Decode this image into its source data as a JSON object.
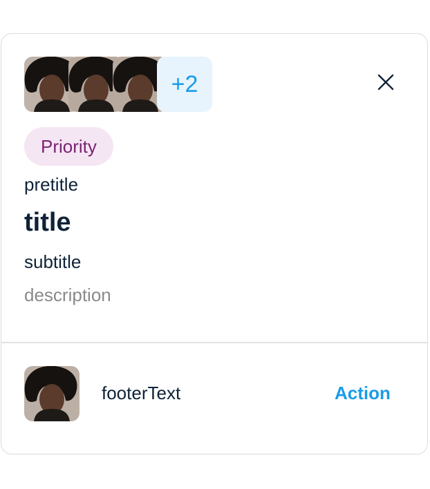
{
  "card": {
    "avatars": [
      "person-photo",
      "person-photo",
      "person-photo"
    ],
    "more_count": "+2",
    "close_icon": "close-icon",
    "badge": "Priority",
    "pretitle": "pretitle",
    "title": "title",
    "subtitle": "subtitle",
    "description": "description",
    "footer": {
      "avatar": "person-photo",
      "text": "footerText",
      "action": "Action"
    }
  },
  "colors": {
    "accent": "#1a9ce8",
    "badge_bg": "#f5e6f3",
    "badge_text": "#7b2373",
    "more_bg": "#e7f3fd",
    "text": "#0f2237",
    "muted": "#8a8a8a"
  }
}
